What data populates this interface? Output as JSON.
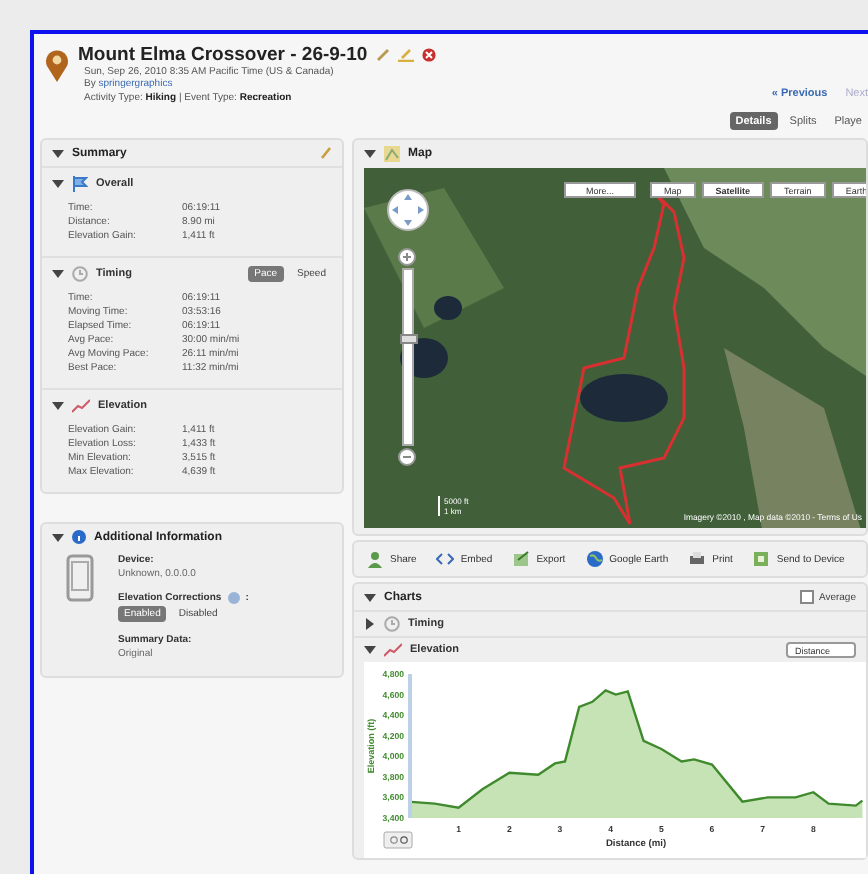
{
  "header": {
    "title": "Mount Elma Crossover - 26-9-10",
    "date": "Sun, Sep 26, 2010 8:35 AM Pacific Time (US & Canada)",
    "by_label": "By",
    "author": "springergraphics",
    "activity_label": "Activity Type:",
    "activity": "Hiking",
    "event_label": "| Event Type:",
    "event": "Recreation",
    "previous": "« Previous",
    "next": "Next",
    "tabs": [
      {
        "label": "Details",
        "selected": true
      },
      {
        "label": "Splits",
        "selected": false
      },
      {
        "label": "Playe",
        "selected": false
      }
    ]
  },
  "summary": {
    "title": "Summary",
    "expanded": true,
    "sections": [
      {
        "kind": "overall",
        "title": "Overall",
        "expanded": true,
        "rows": [
          {
            "label": "Time:",
            "value": "06:19:11"
          },
          {
            "label": "Distance:",
            "value": "8.90 mi"
          },
          {
            "label": "Elevation Gain:",
            "value": "1,411 ft"
          }
        ]
      },
      {
        "kind": "timing",
        "title": "Timing",
        "expanded": true,
        "toggle": [
          {
            "label": "Pace",
            "selected": true
          },
          {
            "label": "Speed",
            "selected": false
          }
        ],
        "rows": [
          {
            "label": "Time:",
            "value": "06:19:11"
          },
          {
            "label": "Moving Time:",
            "value": "03:53:16"
          },
          {
            "label": "Elapsed Time:",
            "value": "06:19:11"
          },
          {
            "label": "Avg Pace:",
            "value": "30:00 min/mi"
          },
          {
            "label": "Avg Moving Pace:",
            "value": "26:11 min/mi"
          },
          {
            "label": "Best Pace:",
            "value": "11:32 min/mi"
          }
        ]
      },
      {
        "kind": "elevation",
        "title": "Elevation",
        "expanded": true,
        "rows": [
          {
            "label": "Elevation Gain:",
            "value": "1,411 ft"
          },
          {
            "label": "Elevation Loss:",
            "value": "1,433 ft"
          },
          {
            "label": "Min Elevation:",
            "value": "3,515 ft"
          },
          {
            "label": "Max Elevation:",
            "value": "4,639 ft"
          }
        ]
      }
    ]
  },
  "additional": {
    "title": "Additional Information",
    "expanded": true,
    "device_label": "Device:",
    "device": "Unknown, 0.0.0.0",
    "corrections_label": "Elevation Corrections",
    "corrections_suffix": ":",
    "corrections": [
      {
        "label": "Enabled",
        "selected": true
      },
      {
        "label": "Disabled",
        "selected": false
      }
    ],
    "summary_label": "Summary Data:",
    "summary_value": "Original"
  },
  "map": {
    "title": "Map",
    "expanded": true,
    "more": "More...",
    "types": [
      {
        "label": "Map",
        "selected": false
      },
      {
        "label": "Satellite",
        "selected": true
      },
      {
        "label": "Terrain",
        "selected": false
      },
      {
        "label": "Earth",
        "selected": false
      }
    ],
    "zoom": {
      "level": 0.62
    },
    "scale_ft": "5000 ft",
    "scale_km": "1 km",
    "attribution": "Imagery ©2010 , Map data ©2010 - Terms of Us"
  },
  "toolbar": [
    {
      "kind": "share",
      "label": "Share"
    },
    {
      "kind": "embed",
      "label": "Embed"
    },
    {
      "kind": "export",
      "label": "Export"
    },
    {
      "kind": "earth",
      "label": "Google Earth"
    },
    {
      "kind": "print",
      "label": "Print"
    },
    {
      "kind": "device",
      "label": "Send to Device"
    }
  ],
  "charts": {
    "title": "Charts",
    "expanded": true,
    "average": {
      "label": "Average",
      "checked": false
    },
    "sections": [
      {
        "kind": "timing",
        "title": "Timing",
        "expanded": false
      },
      {
        "kind": "elevation",
        "title": "Elevation",
        "expanded": true,
        "axis_select": "Distance",
        "chart_data": {
          "type": "area",
          "xlabel": "Distance (mi)",
          "ylabel": "Elevation (ft)",
          "xlim": [
            0,
            9
          ],
          "ylim": [
            3400,
            4800
          ],
          "xticks": [
            1,
            2,
            3,
            4,
            5,
            6,
            7,
            8
          ],
          "yticks": [
            {
              "value": 3400,
              "label": "3,400"
            },
            {
              "value": 3600,
              "label": "3,600"
            },
            {
              "value": 3800,
              "label": "3,800"
            },
            {
              "value": 4000,
              "label": "4,000"
            },
            {
              "value": 4200,
              "label": "4,200"
            },
            {
              "value": 4400,
              "label": "4,400"
            },
            {
              "value": 4600,
              "label": "4,600"
            },
            {
              "value": 4800,
              "label": "4,800"
            }
          ],
          "x": [
            0,
            0.53,
            1,
            1.47,
            2,
            2.57,
            2.9,
            3.1,
            3.38,
            3.64,
            3.9,
            4.1,
            4.34,
            4.65,
            5,
            5.4,
            5.65,
            6,
            6.6,
            7.1,
            7.65,
            8,
            8.3,
            8.84,
            8.97
          ],
          "series": [
            {
              "color": "#3f8a2c",
              "values": [
                3560,
                3540,
                3500,
                3680,
                3840,
                3820,
                3930,
                3950,
                4480,
                4530,
                4640,
                4600,
                4630,
                4150,
                4070,
                3950,
                3970,
                3920,
                3560,
                3600,
                3600,
                3650,
                3540,
                3520,
                3570
              ]
            }
          ]
        }
      }
    ]
  }
}
